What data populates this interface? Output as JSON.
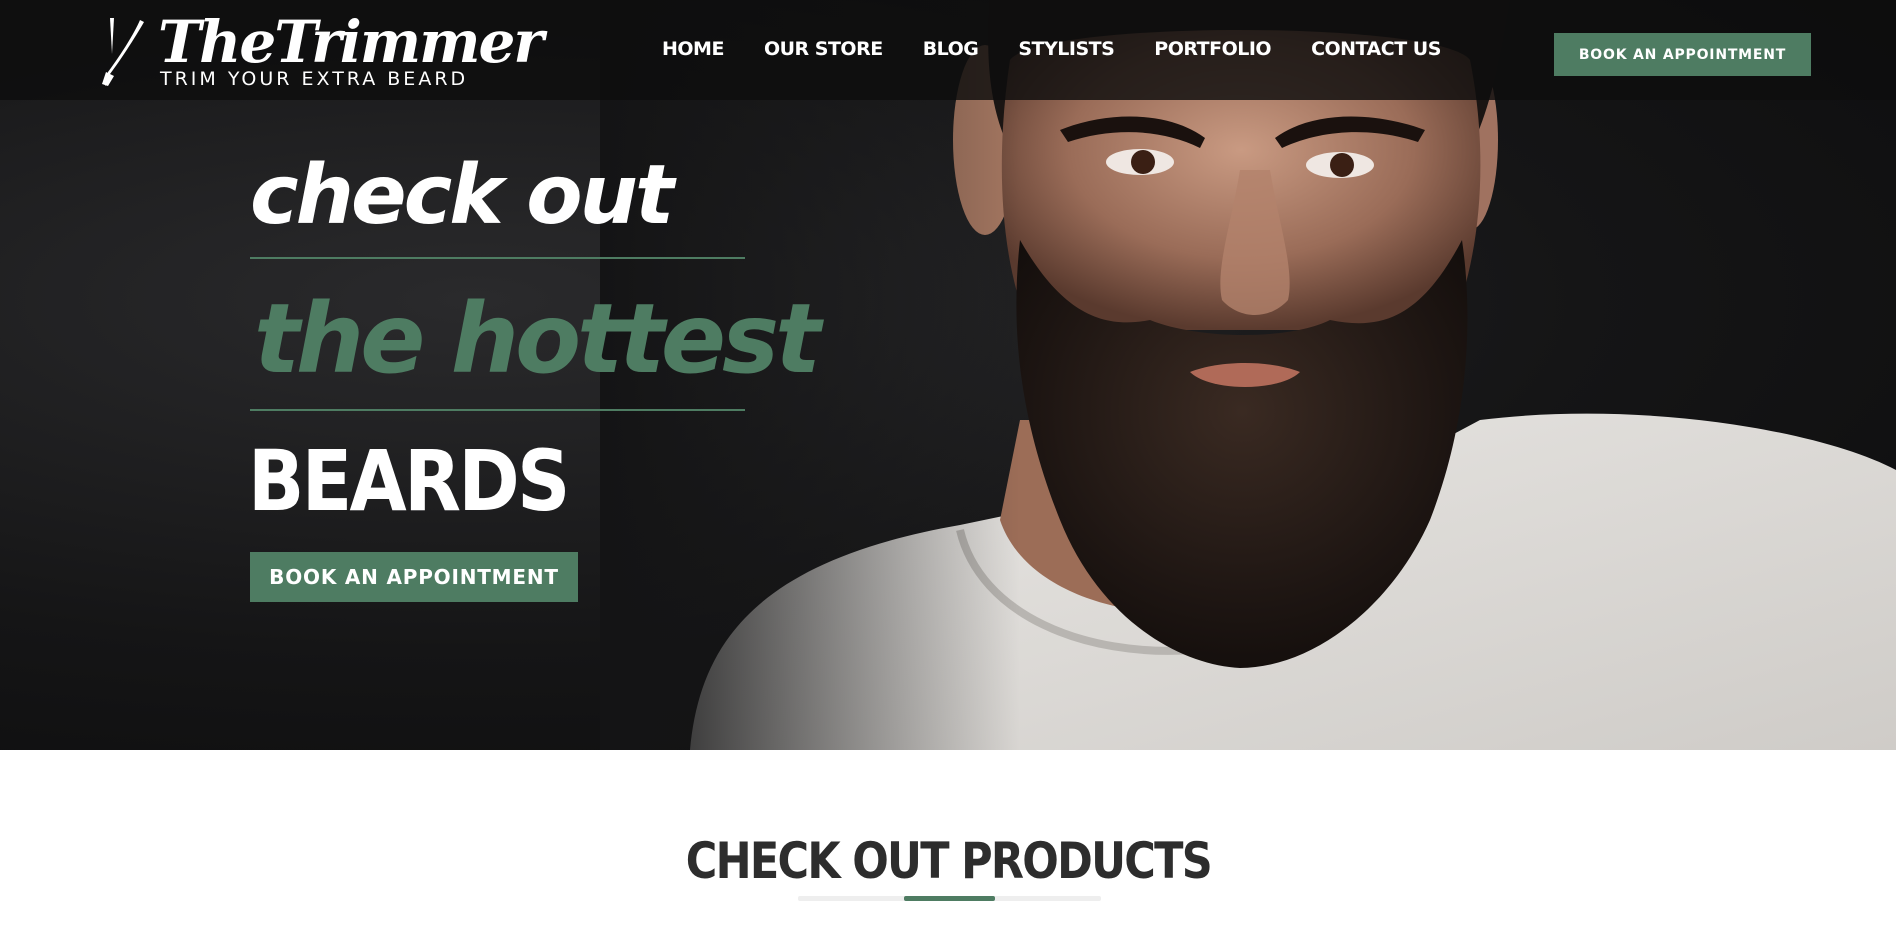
{
  "brand": {
    "name": "TheTrimmer",
    "tagline": "TRIM YOUR EXTRA BEARD",
    "logo_icon": "straight-razor-icon"
  },
  "nav": {
    "items": [
      {
        "label": "HOME"
      },
      {
        "label": "OUR STORE"
      },
      {
        "label": "BLOG"
      },
      {
        "label": "STYLISTS"
      },
      {
        "label": "PORTFOLIO"
      },
      {
        "label": "CONTACT US"
      }
    ],
    "cta_label": "BOOK AN APPOINTMENT"
  },
  "hero": {
    "line1": "check out",
    "line2": "the hottest",
    "line3": "BEARDS",
    "cta_label": "BOOK AN APPOINTMENT",
    "image": "portrait of bearded man in white t-shirt on dark background"
  },
  "products": {
    "title": "CHECK OUT PRODUCTS"
  },
  "colors": {
    "accent": "#4e7c62",
    "hero_bg": "#141415",
    "navbar_bg": "#0e0e0e",
    "heading_dark": "#2d2d2d"
  }
}
